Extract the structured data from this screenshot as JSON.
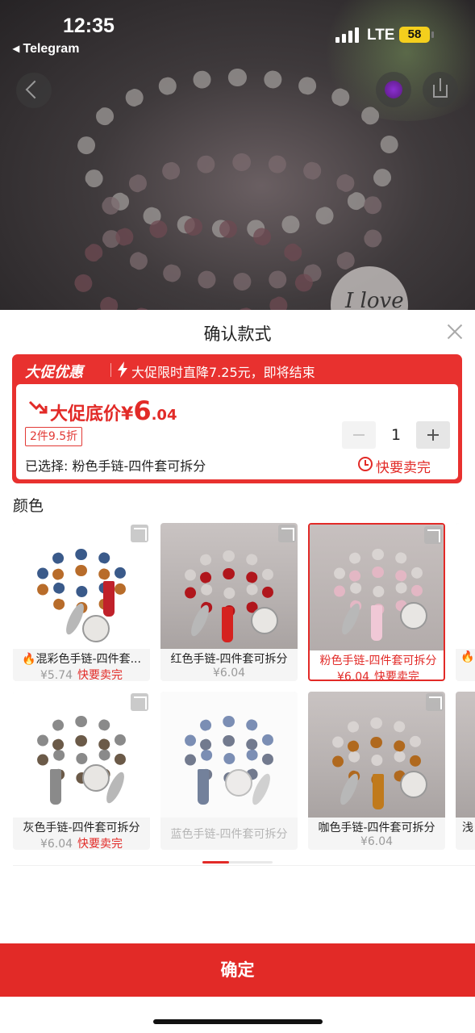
{
  "status_bar": {
    "time": "12:35",
    "back_app": "◂ Telegram",
    "network": "LTE",
    "battery": "58"
  },
  "sheet": {
    "title": "确认款式",
    "promo": {
      "badge": "大促优惠",
      "countdown_text": "大促限时直降7.25元，即将结束",
      "price_prefix": "大促底价¥",
      "price_int": "6",
      "price_dec": ".04",
      "discount_tag": "2件9.5折",
      "selected_text": "已选择: 粉色手链-四件套可拆分",
      "quantity": "1",
      "sell_fast": "快要卖完"
    },
    "section_title": "颜色",
    "options": [
      {
        "name": "混彩色手链-四件套...",
        "price": "¥5.74",
        "hot": "快要卖完",
        "flame": true
      },
      {
        "name": "红色手链-四件套可拆分",
        "price": "¥6.04",
        "hot": "",
        "flame": false
      },
      {
        "name": "粉色手链-四件套可拆分",
        "price": "¥6.04",
        "hot": "快要卖完",
        "flame": false,
        "selected": true
      },
      {
        "name": "灰色手链-四件套可拆分",
        "price": "¥6.04",
        "hot": "快要卖完",
        "flame": false
      },
      {
        "name": "蓝色手链-四件套可拆分",
        "price": "",
        "hot": "",
        "flame": false,
        "disabled": true
      },
      {
        "name": "咖色手链-四件套可拆分",
        "price": "¥6.04",
        "hot": "",
        "flame": false
      },
      {
        "name": "浅",
        "price": "",
        "hot": "",
        "flame": false
      }
    ],
    "confirm_label": "确定"
  },
  "colors": {
    "accent": "#e22a27",
    "promo_bg": "#e8312f"
  }
}
